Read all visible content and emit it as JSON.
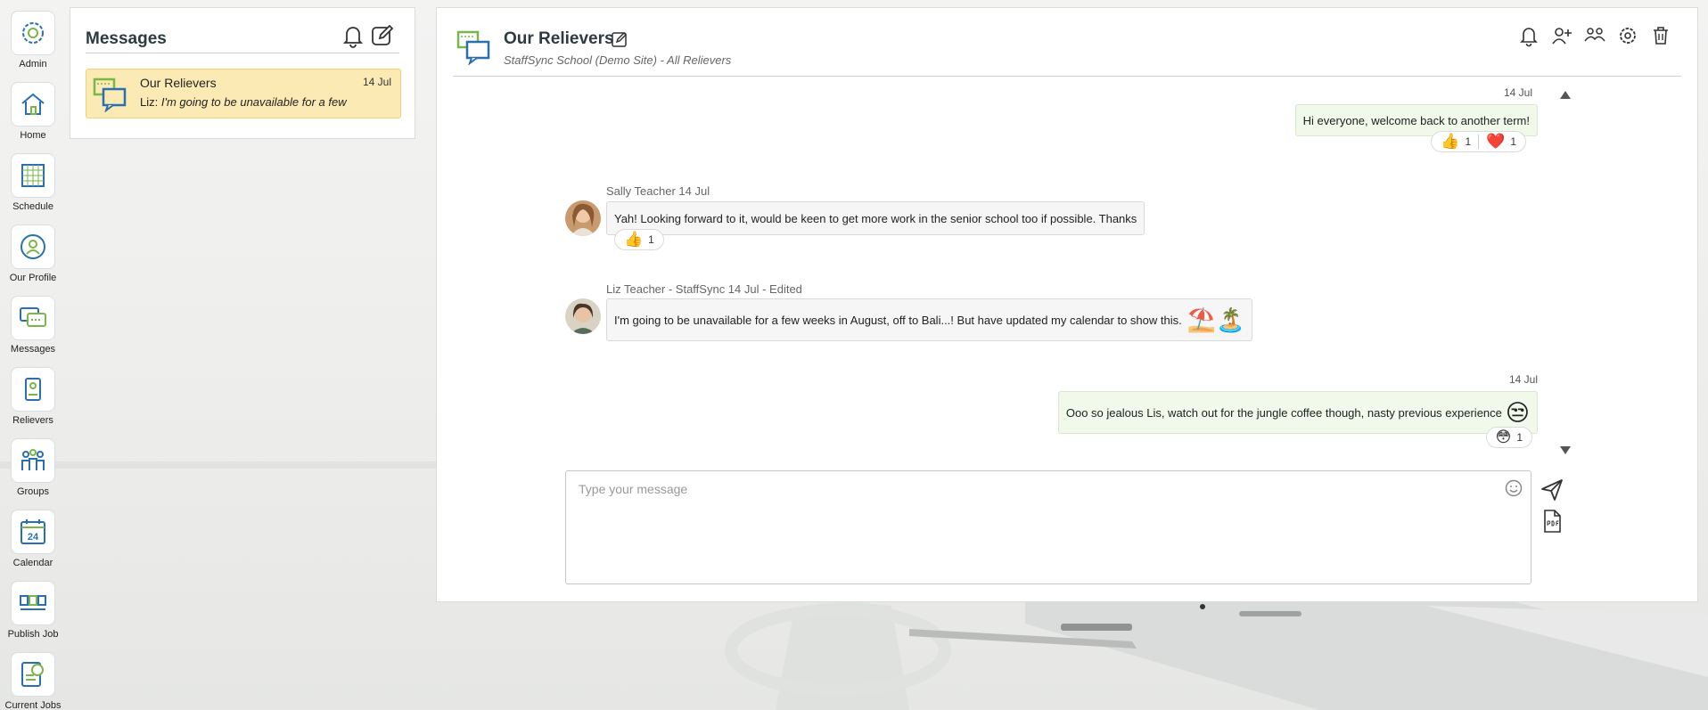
{
  "nav": {
    "items": [
      {
        "label": "Admin",
        "icon": "gear-icon"
      },
      {
        "label": "Home",
        "icon": "home-icon"
      },
      {
        "label": "Schedule",
        "icon": "schedule-icon"
      },
      {
        "label": "Our Profile",
        "icon": "profile-icon"
      },
      {
        "label": "Messages",
        "icon": "messages-icon"
      },
      {
        "label": "Relievers",
        "icon": "relievers-icon"
      },
      {
        "label": "Groups",
        "icon": "groups-icon"
      },
      {
        "label": "Calendar",
        "icon": "calendar-icon"
      },
      {
        "label": "Publish Job",
        "icon": "publish-job-icon"
      },
      {
        "label": "Current Jobs",
        "icon": "current-jobs-icon"
      }
    ],
    "calendar_day": "24"
  },
  "list": {
    "title": "Messages",
    "conversation": {
      "name": "Our Relievers",
      "date": "14 Jul",
      "preview_sender": "Liz:",
      "preview_text": "I'm going to be unavailable for a few"
    }
  },
  "chat": {
    "title": "Our Relievers",
    "subtitle": "StaffSync School (Demo Site) - All Relievers",
    "messages": [
      {
        "date": "14 Jul",
        "text": "Hi everyone, welcome back to another term!",
        "reactions": [
          {
            "emoji": "👍",
            "count": "1"
          },
          {
            "emoji": "❤️",
            "count": "1"
          }
        ]
      },
      {
        "sender": "Sally Teacher 14 Jul",
        "text": "Yah! Looking forward to it, would be keen to get more work in the senior school too if possible. Thanks",
        "reactions": [
          {
            "emoji": "👍",
            "count": "1"
          }
        ]
      },
      {
        "sender": "Liz Teacher - StaffSync 14 Jul - Edited",
        "text": "I'm going to be unavailable for a few weeks in August, off to Bali...! But have updated my calendar to show this.",
        "emojis": "⛱️🏝️"
      },
      {
        "date": "14 Jul",
        "text": "Ooo so jealous Lis, watch out for the jungle coffee though, nasty previous experience",
        "emoji": "😒",
        "reactions": [
          {
            "emoji": "😳",
            "count": "1"
          }
        ]
      }
    ],
    "composer_placeholder": "Type your message"
  },
  "colors": {
    "accent_green": "#7ab648",
    "accent_blue": "#2a6fb1",
    "selected_conversation": "#fbeab4",
    "own_bubble": "#f1f9ea"
  }
}
